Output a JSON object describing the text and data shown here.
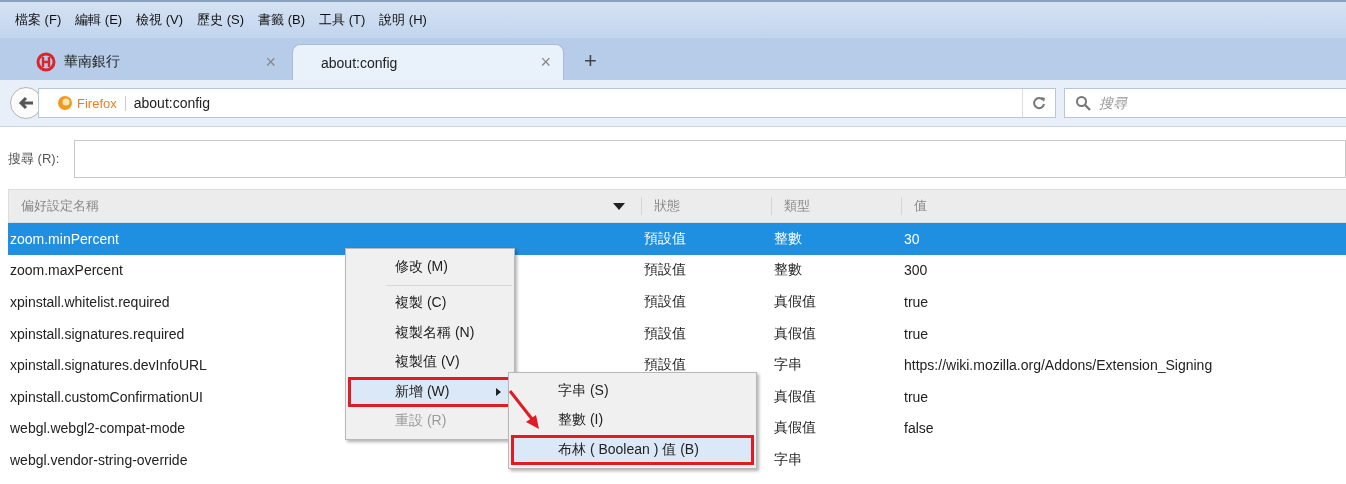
{
  "menu_bar": [
    {
      "label": "檔案 (F)"
    },
    {
      "label": "編輯 (E)"
    },
    {
      "label": "檢視 (V)"
    },
    {
      "label": "歷史 (S)"
    },
    {
      "label": "書籤 (B)"
    },
    {
      "label": "工具 (T)"
    },
    {
      "label": "說明 (H)"
    }
  ],
  "tabs": [
    {
      "title": "華南銀行",
      "close": "×",
      "selected": false
    },
    {
      "title": "about:config",
      "close": "×",
      "selected": true
    }
  ],
  "new_tab": "+",
  "nav_bar": {
    "identity": "Firefox",
    "url": "about:config",
    "search_placeholder": "搜尋"
  },
  "filter": {
    "label": "搜尋 (R):"
  },
  "table": {
    "columns": [
      "偏好設定名稱",
      "狀態",
      "類型",
      "值"
    ],
    "rows": [
      {
        "name": "zoom.minPercent",
        "status": "預設值",
        "type": "整數",
        "value": "30",
        "selected": true
      },
      {
        "name": "zoom.maxPercent",
        "status": "預設值",
        "type": "整數",
        "value": "300",
        "selected": false
      },
      {
        "name": "xpinstall.whitelist.required",
        "status": "預設值",
        "type": "真假值",
        "value": "true",
        "selected": false
      },
      {
        "name": "xpinstall.signatures.required",
        "status": "預設值",
        "type": "真假值",
        "value": "true",
        "selected": false
      },
      {
        "name": "xpinstall.signatures.devInfoURL",
        "status": "預設值",
        "type": "字串",
        "value": "https://wiki.mozilla.org/Addons/Extension_Signing",
        "selected": false
      },
      {
        "name": "xpinstall.customConfirmationUI",
        "type": "真假值",
        "value": "true",
        "selected": false
      },
      {
        "name": "webgl.webgl2-compat-mode",
        "type": "真假值",
        "value": "false",
        "selected": false
      },
      {
        "name": "webgl.vendor-string-override",
        "type": "字串",
        "selected": false
      }
    ]
  },
  "context_menu": {
    "items": [
      {
        "kind": "item",
        "label": "修改 (M)",
        "disabled": false,
        "highlighted": false
      },
      {
        "kind": "separator"
      },
      {
        "kind": "item",
        "label": "複製 (C)",
        "disabled": false,
        "highlighted": false
      },
      {
        "kind": "item",
        "label": "複製名稱 (N)",
        "disabled": false,
        "highlighted": false
      },
      {
        "kind": "item",
        "label": "複製值 (V)",
        "disabled": false,
        "highlighted": false
      },
      {
        "kind": "submenu",
        "label": "新增 (W)",
        "disabled": false,
        "highlighted": true
      },
      {
        "kind": "item",
        "label": "重設 (R)",
        "disabled": true,
        "highlighted": false
      }
    ],
    "submenu": [
      {
        "label": "字串 (S)",
        "highlighted": false
      },
      {
        "label": "整數 (I)",
        "highlighted": false
      },
      {
        "label": "布林 ( Boolean ) 值 (B)",
        "highlighted": true
      }
    ]
  }
}
